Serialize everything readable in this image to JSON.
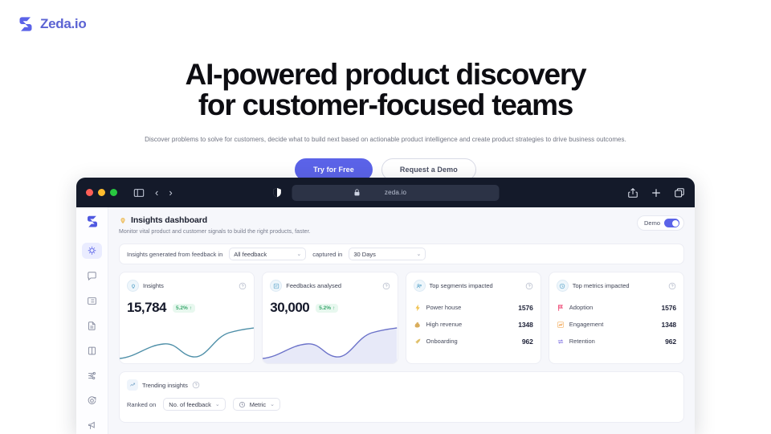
{
  "brand": {
    "name": "Zeda.io",
    "logo_icon": "zeda-logo-icon",
    "accent": "#5b63e8",
    "logo_color": "#5b63d3"
  },
  "hero": {
    "headline_line1": "AI-powered product discovery",
    "headline_line2": "for customer-focused teams",
    "subtitle": "Discover problems to solve for customers, decide what to build next based on actionable product intelligence and create product strategies to drive business outcomes.",
    "primary_cta": "Try for Free",
    "secondary_cta": "Request a Demo"
  },
  "browser": {
    "url": "zeda.io",
    "lock_icon": "lock-icon",
    "shield_icon": "shield-icon",
    "sidebar_toggle_icon": "sidebar-toggle-icon",
    "back_icon": "chevron-left-icon",
    "forward_icon": "chevron-right-icon",
    "back_label": "‹",
    "forward_label": "›",
    "share_icon": "share-icon",
    "new_tab_icon": "plus-icon",
    "tabs_icon": "tabs-overview-icon",
    "traffic_lights": [
      "close",
      "minimize",
      "zoom"
    ]
  },
  "app": {
    "sidebar": {
      "logo_icon": "zeda-mark-icon",
      "items": [
        {
          "name": "insights",
          "icon": "lightbulb-icon",
          "active": true
        },
        {
          "name": "feedback",
          "icon": "comment-icon",
          "active": false
        },
        {
          "name": "notes",
          "icon": "list-card-icon",
          "active": false
        },
        {
          "name": "documents",
          "icon": "document-icon",
          "active": false
        },
        {
          "name": "releases",
          "icon": "box-icon",
          "active": false
        },
        {
          "name": "roadmap",
          "icon": "sliders-icon",
          "active": false
        },
        {
          "name": "goals",
          "icon": "target-icon",
          "active": false
        },
        {
          "name": "announcements",
          "icon": "megaphone-icon",
          "active": false
        }
      ]
    },
    "header": {
      "icon": "lightbulb-icon",
      "title": "Insights dashboard",
      "subtitle": "Monitor vital product and customer signals to build the right products, faster.",
      "demo_label": "Demo",
      "demo_on": true
    },
    "filters": {
      "prefix_label": "Insights generated from feedback in",
      "feedback_select": "All feedback",
      "middle_label": "captured in",
      "period_select": "30 Days",
      "chevron": "⌄"
    },
    "cards": [
      {
        "type": "kpi",
        "icon": "insight-bulb-icon",
        "title": "Insights",
        "value": "15,784",
        "delta": "5.2%",
        "delta_arrow": "↑",
        "delta_direction": "up",
        "help_icon": "help-circle-icon",
        "spark_color": "#4e8fa8"
      },
      {
        "type": "kpi",
        "icon": "feedback-grid-icon",
        "title": "Feedbacks analysed",
        "value": "30,000",
        "delta": "5.2%",
        "delta_arrow": "↑",
        "delta_direction": "up",
        "help_icon": "help-circle-icon",
        "spark_color": "#6b72c9"
      },
      {
        "type": "list",
        "icon": "segments-icon",
        "title": "Top segments impacted",
        "help_icon": "help-circle-icon",
        "rows": [
          {
            "icon": "lightning-icon",
            "label": "Power house",
            "value": "1576"
          },
          {
            "icon": "money-bag-icon",
            "label": "High revenue",
            "value": "1348"
          },
          {
            "icon": "rocket-icon",
            "label": "Onboarding",
            "value": "962"
          }
        ]
      },
      {
        "type": "list",
        "icon": "metrics-clock-icon",
        "title": "Top metrics impacted",
        "help_icon": "help-circle-icon",
        "rows": [
          {
            "icon": "flag-icon",
            "label": "Adoption",
            "value": "1576"
          },
          {
            "icon": "chart-up-icon",
            "label": "Engagement",
            "value": "1348"
          },
          {
            "icon": "refresh-icon",
            "label": "Retention",
            "value": "962"
          }
        ]
      }
    ],
    "trending": {
      "icon": "trending-icon",
      "title": "Trending insights",
      "help_icon": "help-circle-icon",
      "ranked_label": "Ranked on",
      "rank_select": "No. of feedback",
      "metric_icon": "metric-icon",
      "metric_select": "Metric",
      "chevron": "⌄"
    }
  }
}
